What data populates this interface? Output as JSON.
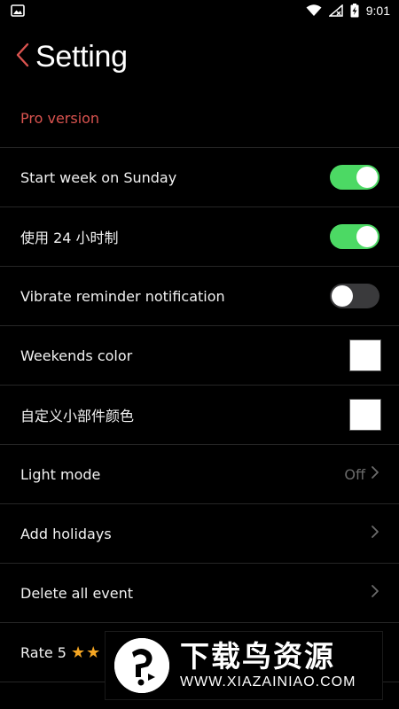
{
  "status_bar": {
    "time": "9:01"
  },
  "header": {
    "title": "Setting"
  },
  "settings": {
    "pro_label": "Pro version",
    "start_week": {
      "label": "Start week on Sunday",
      "state": "on"
    },
    "hour24": {
      "label": "使用 24 小时制",
      "state": "on"
    },
    "vibrate": {
      "label": "Vibrate reminder notification",
      "state": "off"
    },
    "weekends_color": {
      "label": "Weekends color",
      "color": "#ffffff"
    },
    "widget_color": {
      "label": "自定义小部件颜色",
      "color": "#ffffff"
    },
    "light_mode": {
      "label": "Light mode",
      "value": "Off"
    },
    "add_holidays": {
      "label": "Add holidays"
    },
    "delete_all": {
      "label": "Delete all event"
    },
    "rate": {
      "label": "Rate 5",
      "stars": "★★"
    }
  },
  "watermark": {
    "cn": "下载鸟资源",
    "url": "WWW.XIAZAINIAO.COM"
  },
  "colors": {
    "accent_green": "#4cd964",
    "pro_red": "#d9534f",
    "star_gold": "#f5a623"
  }
}
